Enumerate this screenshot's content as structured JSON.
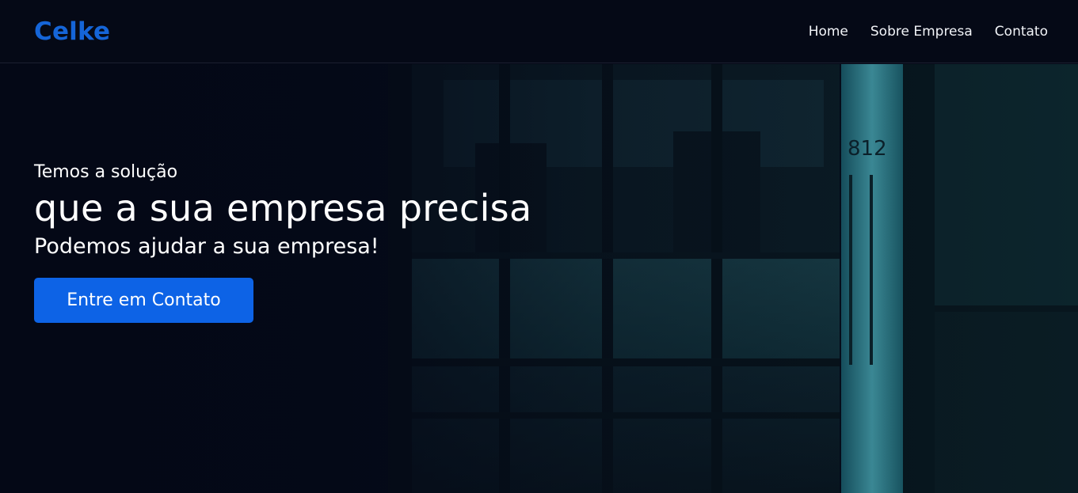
{
  "brand": {
    "name": "Celke",
    "color": "#1565d8"
  },
  "nav": {
    "items": [
      {
        "label": "Home"
      },
      {
        "label": "Sobre Empresa"
      },
      {
        "label": "Contato"
      }
    ]
  },
  "hero": {
    "kicker": "Temos a solução",
    "title": "que a sua empresa precisa",
    "subtitle": "Podemos ajudar a sua empresa!",
    "cta_label": "Entre em Contato",
    "cta_color": "#0d63e6",
    "background_image": "night-office-building-glass-facade",
    "door_number": "812"
  }
}
